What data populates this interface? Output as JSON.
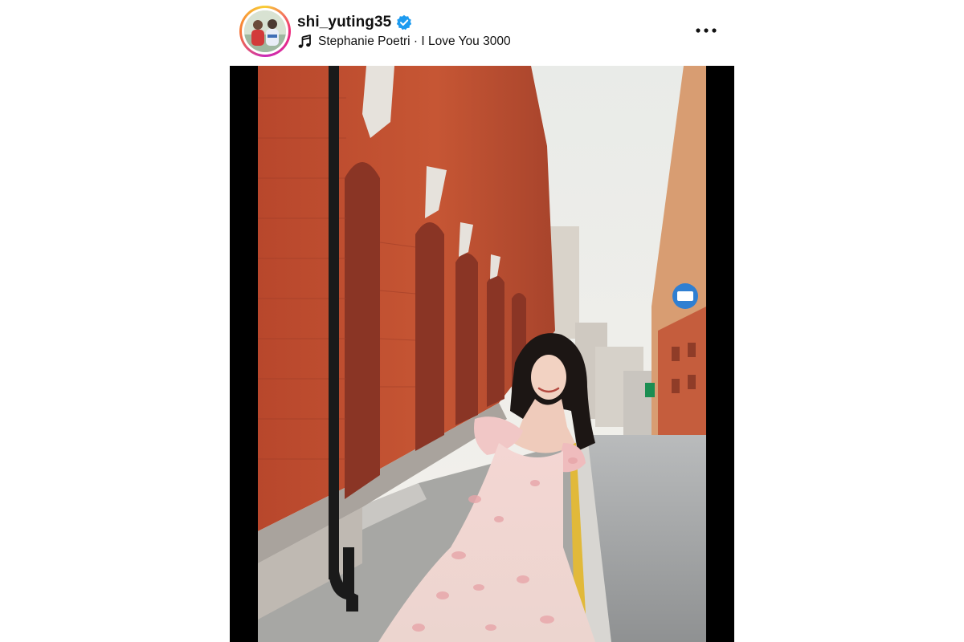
{
  "post": {
    "username": "shi_yuting35",
    "verified": true,
    "audio": "Stephanie Poetri · I Love You 3000",
    "icons": {
      "verified": "verified-badge-icon",
      "audio": "music-note-icon",
      "more": "more-options-icon"
    },
    "colors": {
      "verified": "#1d9bf0",
      "text": "#111111",
      "letterbox": "#000000"
    }
  }
}
